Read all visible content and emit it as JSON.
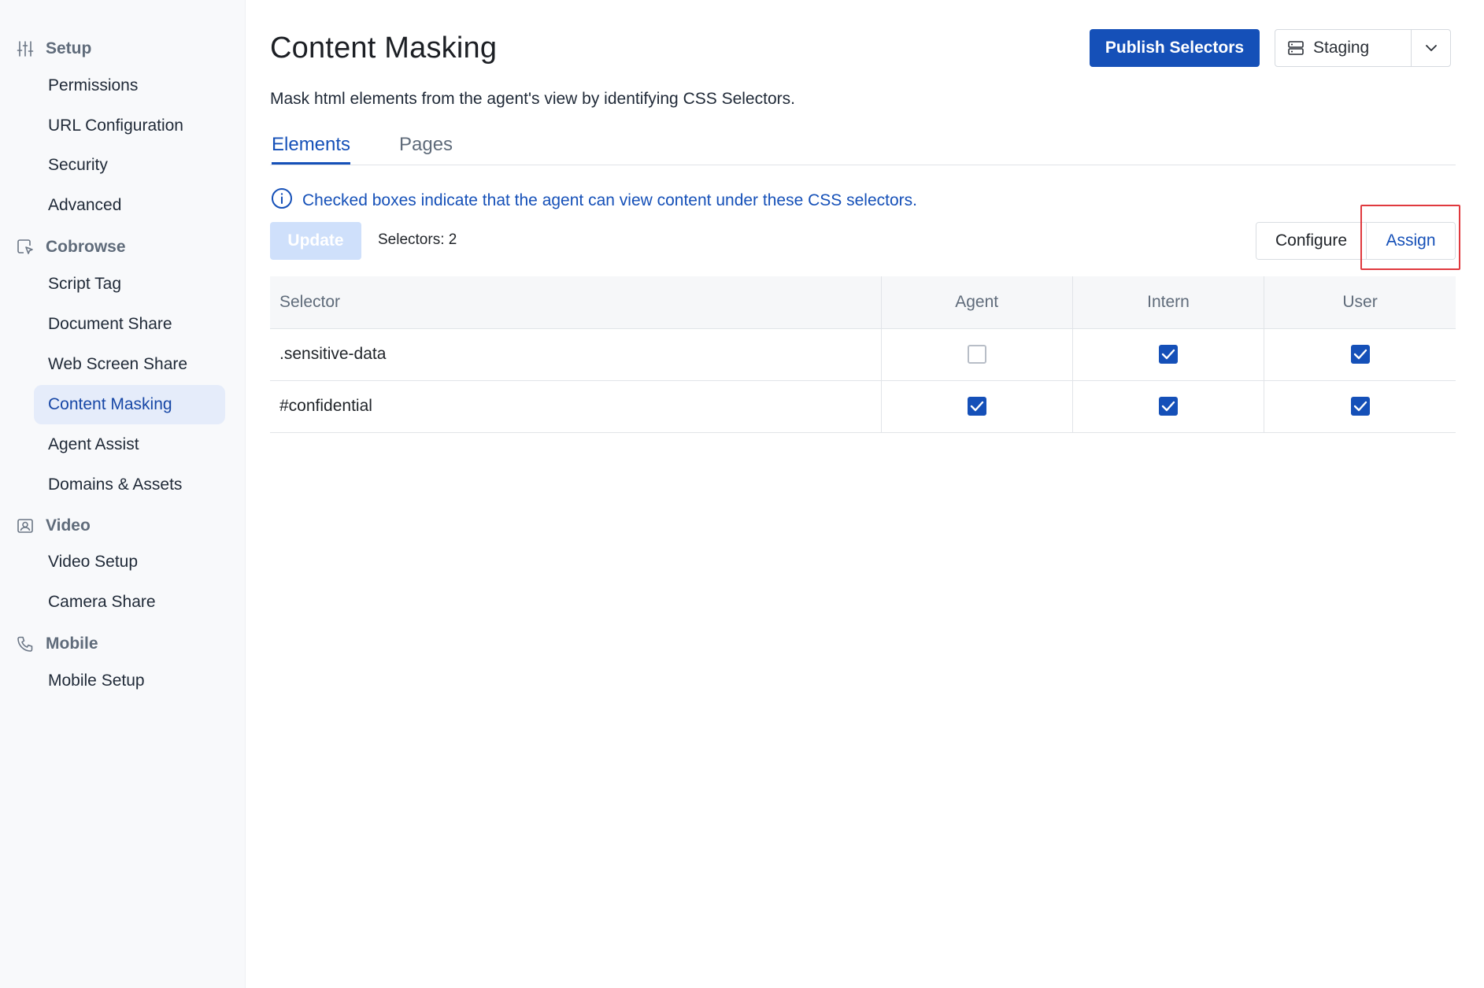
{
  "sidebar": {
    "sections": [
      {
        "label": "Setup",
        "icon": "sliders-icon"
      },
      {
        "label": "Cobrowse",
        "icon": "cobrowse-icon"
      },
      {
        "label": "Video",
        "icon": "video-icon"
      },
      {
        "label": "Mobile",
        "icon": "phone-icon"
      }
    ],
    "items": [
      {
        "label": "Permissions"
      },
      {
        "label": "URL Configuration"
      },
      {
        "label": "Security"
      },
      {
        "label": "Advanced"
      },
      {
        "label": "Script Tag"
      },
      {
        "label": "Document Share"
      },
      {
        "label": "Web Screen Share"
      },
      {
        "label": "Content Masking",
        "active": true
      },
      {
        "label": "Agent Assist"
      },
      {
        "label": "Domains & Assets"
      },
      {
        "label": "Video Setup"
      },
      {
        "label": "Camera Share"
      },
      {
        "label": "Mobile Setup"
      }
    ]
  },
  "header": {
    "title": "Content Masking",
    "subtitle": "Mask html elements from the agent's view by identifying CSS Selectors.",
    "publish_label": "Publish Selectors",
    "environment": "Staging"
  },
  "tabs": [
    {
      "label": "Elements",
      "active": true
    },
    {
      "label": "Pages",
      "active": false
    }
  ],
  "info_text": "Checked boxes indicate that the agent can view content under these CSS selectors.",
  "toolbar": {
    "update_label": "Update",
    "selectors_count": "Selectors: 2",
    "configure_label": "Configure",
    "assign_label": "Assign"
  },
  "table": {
    "headers": [
      "Selector",
      "Agent",
      "Intern",
      "User"
    ],
    "rows": [
      {
        "selector": ".sensitive-data",
        "agent": false,
        "intern": true,
        "user": true
      },
      {
        "selector": "#confidential",
        "agent": true,
        "intern": true,
        "user": true
      }
    ]
  },
  "colors": {
    "primary": "#1550b8",
    "active_nav_bg": "#e5ecfa",
    "highlight": "#e0393e"
  }
}
